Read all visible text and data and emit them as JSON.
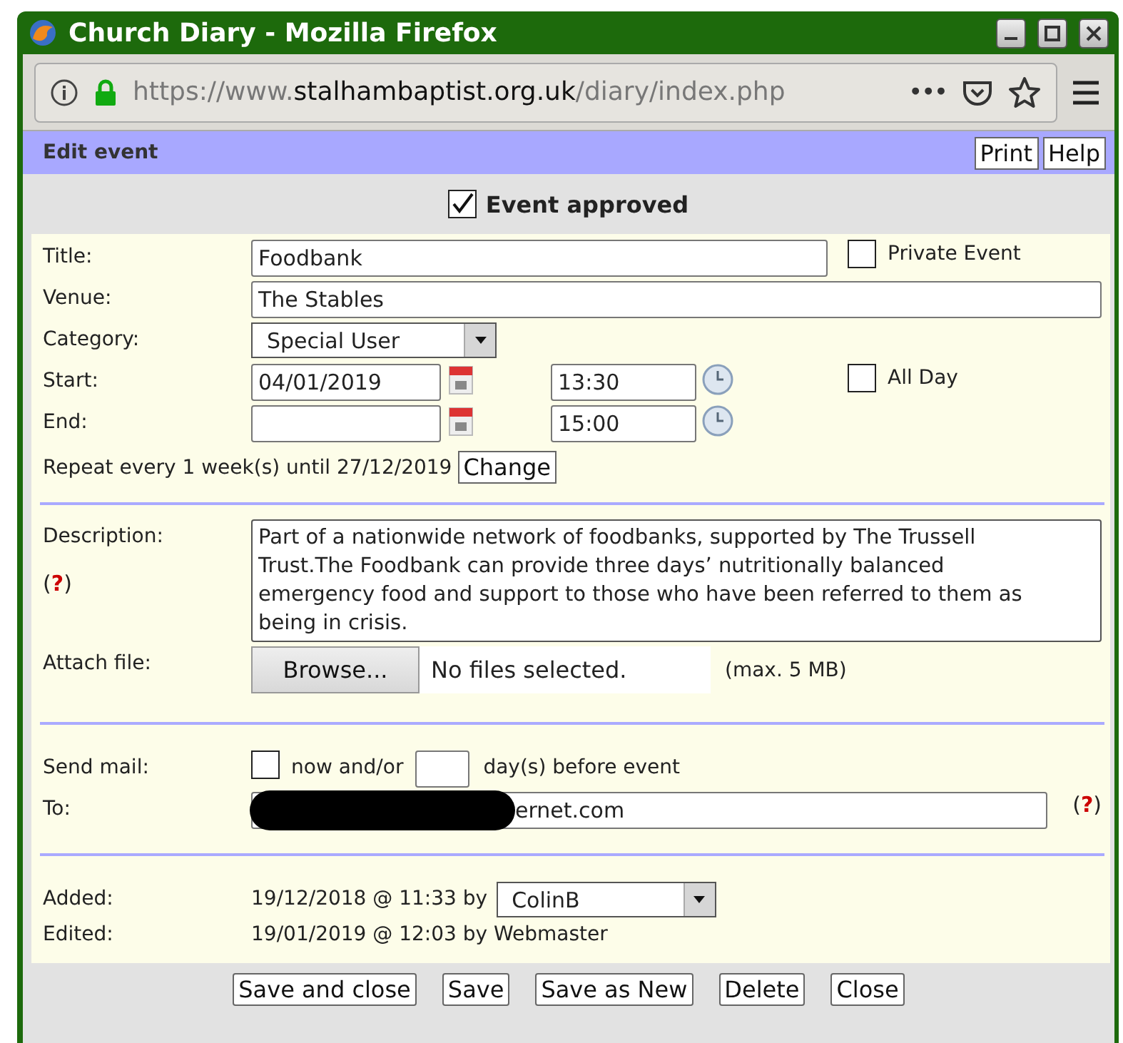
{
  "window": {
    "title": "Church Diary - Mozilla Firefox"
  },
  "browser": {
    "url_scheme": "https://www.",
    "url_domain": "stalhambaptist.org.uk",
    "url_path": "/diary/index.php",
    "more": "•••"
  },
  "header": {
    "title": "Edit event",
    "buttons": [
      "Print",
      "Help"
    ]
  },
  "approved": {
    "label": "Event approved",
    "checked": true
  },
  "title_field": {
    "label": "Title:",
    "value": "Foodbank"
  },
  "private": {
    "label": "Private Event",
    "checked": false
  },
  "venue": {
    "label": "Venue:",
    "value": "The Stables"
  },
  "category": {
    "label": "Category:",
    "value": "Special User"
  },
  "start": {
    "label": "Start:",
    "date": "04/01/2019",
    "time": "13:30"
  },
  "all_day": {
    "label": "All Day",
    "checked": false
  },
  "end": {
    "label": "End:",
    "time": "15:00"
  },
  "repeat": {
    "text": "Repeat every 1 week(s) until 27/12/2019",
    "button": "Change"
  },
  "description": {
    "label": "Description:",
    "help_open": "(",
    "help_mark": "?",
    "help_close": ")",
    "value": "Part of a nationwide network of foodbanks, supported by The Trussell Trust.The Foodbank can provide three days’ nutritionally balanced emergency food and support to those who have been referred to them as being in crisis."
  },
  "attach": {
    "label": "Attach file:",
    "button": "Browse...",
    "status": "No files selected.",
    "note": "(max. 5 MB)"
  },
  "send_mail": {
    "label": "Send mail:",
    "now_checked": false,
    "now_label": "now and/or",
    "days_label": "day(s) before event"
  },
  "to": {
    "label": "To:",
    "value": "ernet.com",
    "redacted": true,
    "help_open": "(",
    "help_mark": "?",
    "help_close": ")"
  },
  "added": {
    "label": "Added:",
    "text": "19/12/2018 @ 11:33 by",
    "user": "ColinB"
  },
  "edited": {
    "label": "Edited:",
    "text": "19/01/2019 @ 12:03 by Webmaster"
  },
  "actions": [
    "Save and close",
    "Save",
    "Save as New",
    "Delete",
    "Close"
  ]
}
